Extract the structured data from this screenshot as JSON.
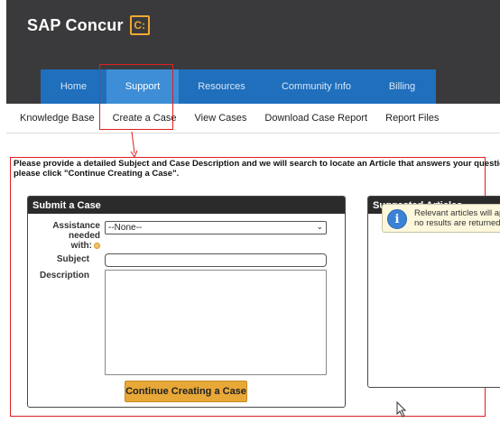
{
  "header": {
    "logo_text": "SAP Concur",
    "logo_mark": "C:"
  },
  "tabs": [
    {
      "label": "Home"
    },
    {
      "label": "Support",
      "active": true
    },
    {
      "label": "Resources"
    },
    {
      "label": "Community Info"
    },
    {
      "label": "Billing"
    }
  ],
  "subnav": [
    {
      "label": "Knowledge Base"
    },
    {
      "label": "Create a Case"
    },
    {
      "label": "View Cases"
    },
    {
      "label": "Download Case Report"
    },
    {
      "label": "Report Files"
    }
  ],
  "instructions": {
    "line1": "Please provide a detailed Subject and Case Description and we will search to locate an Article that answers your question",
    "line2": "please click \"Continue Creating a Case\"."
  },
  "submit_panel": {
    "title": "Submit a Case",
    "assistance_label_1": "Assistance",
    "assistance_label_2": "needed",
    "assistance_label_3": "with:",
    "assistance_value": "--None--",
    "subject_label": "Subject",
    "subject_value": "",
    "description_label": "Description",
    "description_value": "",
    "continue_button": "Continue Creating a Case"
  },
  "suggested_panel": {
    "title": "Suggested Articles",
    "notice_line1": "Relevant articles will ap",
    "notice_line2": "no results are returned"
  },
  "colors": {
    "header_bg": "#3a3a3c",
    "tab_bg": "#1f6fbd",
    "tab_active_bg": "#3d8ed6",
    "brand_accent": "#f0a830",
    "highlight_red": "#e02020",
    "button_bg": "#e8a838"
  },
  "icons": {
    "info": "info-icon",
    "required": "required-dot-icon",
    "select_arrow": "chevron-down-icon",
    "cursor": "mouse-pointer-icon"
  }
}
